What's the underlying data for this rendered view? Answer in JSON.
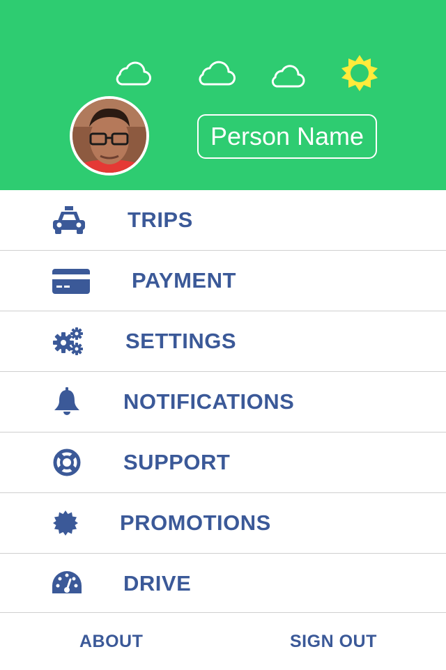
{
  "colors": {
    "header_background": "#2ecc71",
    "accent_blue": "#3b5998",
    "sun_yellow": "#ffeb3b",
    "white": "#ffffff"
  },
  "weather": {
    "icons": [
      "cloud-icon",
      "cloud-icon",
      "cloud-icon",
      "sun-icon"
    ]
  },
  "profile": {
    "name": "Person Name"
  },
  "menu": {
    "items": [
      {
        "label": "TRIPS",
        "icon": "taxi-icon"
      },
      {
        "label": "PAYMENT",
        "icon": "credit-card-icon"
      },
      {
        "label": "SETTINGS",
        "icon": "gears-icon"
      },
      {
        "label": "NOTIFICATIONS",
        "icon": "bell-icon"
      },
      {
        "label": "SUPPORT",
        "icon": "life-ring-icon"
      },
      {
        "label": "PROMOTIONS",
        "icon": "badge-icon"
      },
      {
        "label": "DRIVE",
        "icon": "dashboard-icon"
      }
    ]
  },
  "footer": {
    "about": "ABOUT",
    "sign_out": "SIGN OUT"
  }
}
